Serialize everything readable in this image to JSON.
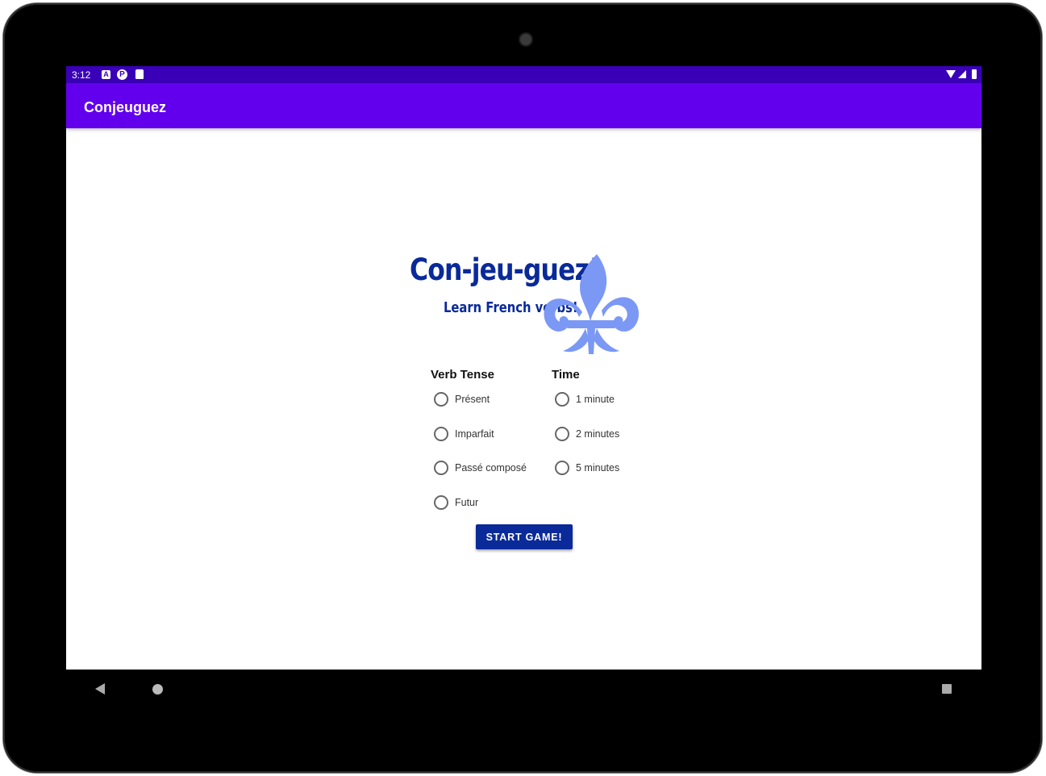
{
  "status_bar": {
    "time": "3:12",
    "notification_icons": [
      "a-icon",
      "pocket-casts-icon",
      "sd-card-icon"
    ],
    "system_icons": [
      "wifi-icon",
      "signal-icon",
      "battery-icon"
    ]
  },
  "app_bar": {
    "title": "Conjeuguez",
    "background_color": "#6200ee",
    "status_bar_color": "#3a00b8"
  },
  "logo": {
    "title": "Con-jeu-guez!",
    "subtitle": "Learn French verbs!",
    "icon": "fleur-de-lis-icon",
    "text_color": "#0a2a9a",
    "icon_color": "#7b98f5"
  },
  "verb_tense": {
    "heading": "Verb Tense",
    "options": [
      {
        "label": "Présent",
        "checked": false
      },
      {
        "label": "Imparfait",
        "checked": false
      },
      {
        "label": "Passé composé",
        "checked": false
      },
      {
        "label": "Futur",
        "checked": false
      }
    ]
  },
  "time": {
    "heading": "Time",
    "options": [
      {
        "label": "1 minute",
        "checked": false
      },
      {
        "label": "2 minutes",
        "checked": false
      },
      {
        "label": "5 minutes",
        "checked": false
      }
    ]
  },
  "start_button": {
    "label": "START GAME!",
    "color": "#0a2a9a"
  },
  "nav_bar": {
    "buttons": [
      "back-icon",
      "home-icon",
      "recents-icon"
    ]
  }
}
